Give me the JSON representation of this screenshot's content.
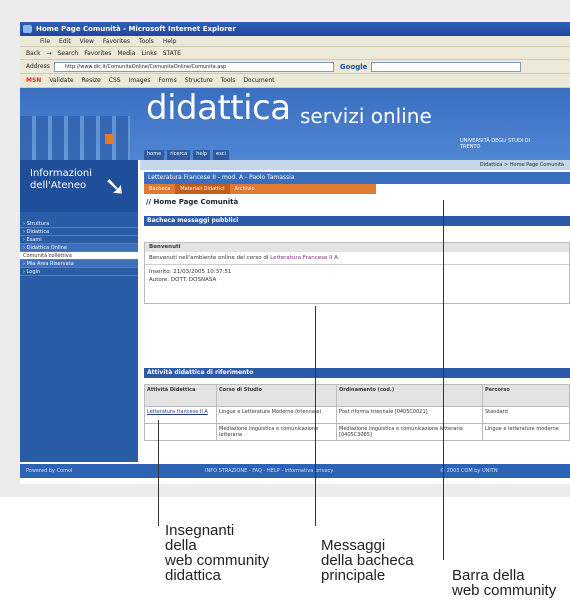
{
  "browser": {
    "window_title": "Home Page Comunità - Microsoft Internet Explorer",
    "menu": [
      "File",
      "Edit",
      "View",
      "Favorites",
      "Tools",
      "Help"
    ],
    "toolbar": [
      "Back",
      "→",
      "Search",
      "Favorites",
      "Media",
      "Links",
      "STATE"
    ],
    "address_label": "Address",
    "address_value": "http://www.dic.it/ComunitaOnline/ComunitaOnline/Comunita.asp",
    "search_brand": "Google",
    "links_items": [
      "MSN",
      "Validate",
      "Resize",
      "CSS",
      "Images",
      "Forms",
      "Structure",
      "Tools",
      "Document"
    ]
  },
  "site": {
    "brand": "didattica",
    "brand_sub_1": "servizi",
    "brand_sub_2": "online",
    "university": "UNIVERSITÀ DEGLI STUDI DI TRENTO",
    "topnav": [
      "home",
      "ricerca",
      "help",
      "esci"
    ],
    "breadcrumb": "Didattica > Home Page Comunità"
  },
  "sidebar": {
    "title": "Informazioni dell'Ateneo",
    "items": [
      {
        "label": "› Struttura",
        "style": "link"
      },
      {
        "label": "› Didattica",
        "style": "link"
      },
      {
        "label": "› Esami",
        "style": "link"
      },
      {
        "label": "› Didattica Online",
        "style": "hl"
      },
      {
        "label": "Comunità collettiva",
        "style": "plain"
      },
      {
        "label": "› Mia Area Riservata",
        "style": "hl"
      },
      {
        "label": "› Login",
        "style": "link"
      }
    ]
  },
  "main": {
    "course_title": "Letteratura Francese II - mod. A - Paolo Tamassia",
    "tabs": [
      "Bacheca",
      "Materiali Didattici",
      "Archivio"
    ],
    "page_heading": "// Home Page Comunità",
    "board_title": "Bacheca messaggi pubblici",
    "board": {
      "header": "Benvenuti",
      "message_prefix": "Benvenuti nell'ambiente online del corso di",
      "message_link": "Letteratura Francese II A",
      "inserted": "Inserito: 21/03/2005 10:37:51",
      "author": "Autore: DOTT. DOSNASA"
    },
    "activities_title": "Attività didattica di riferimento",
    "table": {
      "headers": [
        "Attività Didattica",
        "Corso di Studio",
        "Ordinamento (cod.)",
        "Percorso"
      ],
      "rows": [
        [
          "Letteratura francese II A",
          "Lingue e Letterature Moderne (triennale)",
          "Post riforma triennale [0405C0021]",
          "Standard"
        ],
        [
          "",
          "Mediazione linguistica e comunicazione letteraria",
          "Mediazione linguistica e comunicazione letteraria [0405C3065]",
          "Lingue e letterature moderne"
        ]
      ]
    }
  },
  "footer": {
    "left": "Powered by Comol",
    "mid": "INFO STRAZIONE - FAQ - HELP - Informativa privacy",
    "right": "© 2003 COM by UNITN"
  },
  "callouts": {
    "teachers": "Insegnanti\ndella\nweb community\ndidattica",
    "messages": "Messaggi\ndella bacheca\nprincipale",
    "bar": "Barra della\nweb community"
  }
}
